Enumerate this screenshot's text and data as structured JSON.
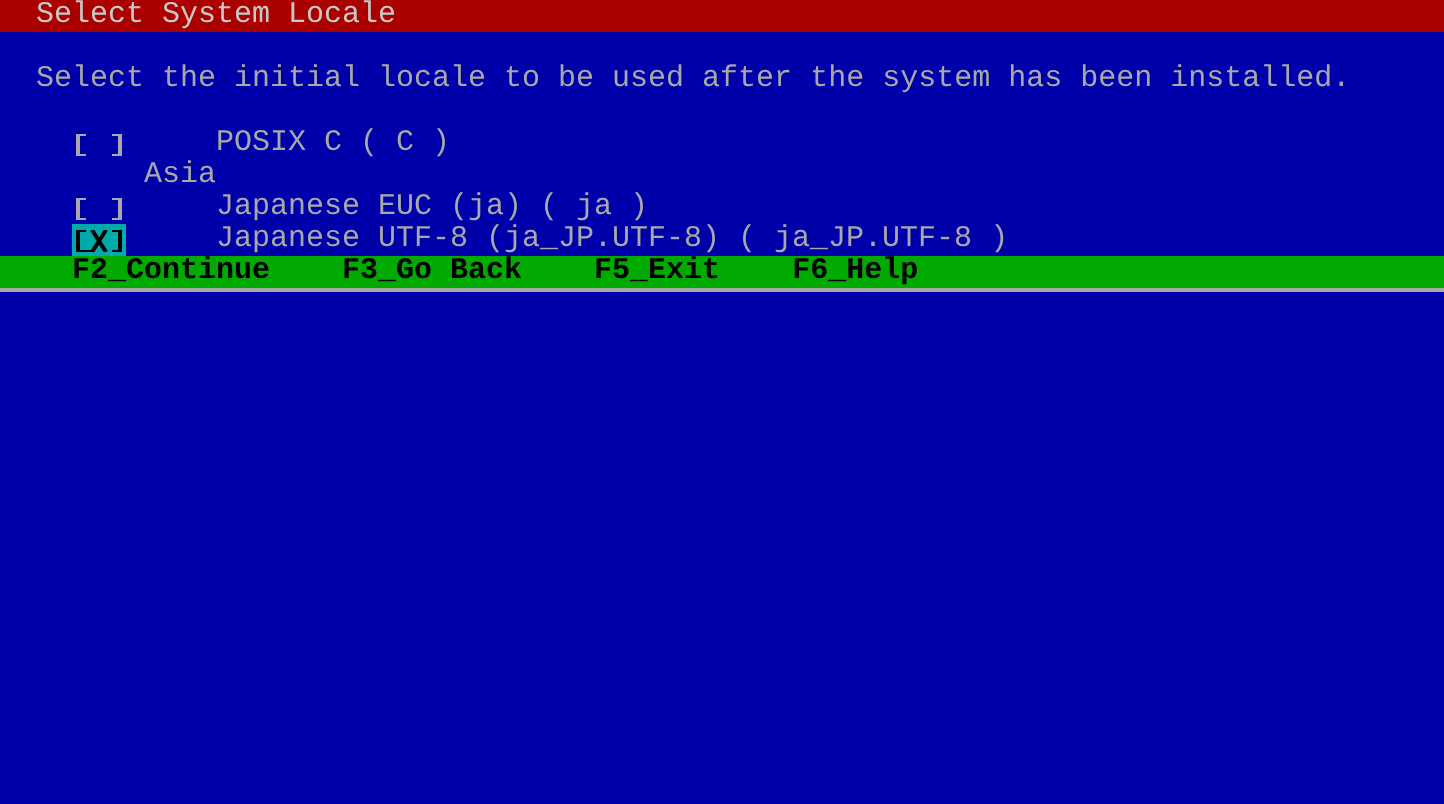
{
  "title": "Select System Locale",
  "prompt": "Select the initial locale to be used after the system has been installed.",
  "items": [
    {
      "kind": "option",
      "label": "POSIX C ( C )",
      "checked": false,
      "focused": false
    },
    {
      "kind": "group",
      "label": "Asia"
    },
    {
      "kind": "option",
      "label": "Japanese EUC (ja) ( ja )",
      "checked": false,
      "focused": false
    },
    {
      "kind": "option",
      "label": "Japanese UTF-8 (ja_JP.UTF-8) ( ja_JP.UTF-8 )",
      "checked": true,
      "focused": true
    }
  ],
  "footer": [
    "F2_Continue",
    "F3_Go Back",
    "F5_Exit",
    "F6_Help"
  ]
}
